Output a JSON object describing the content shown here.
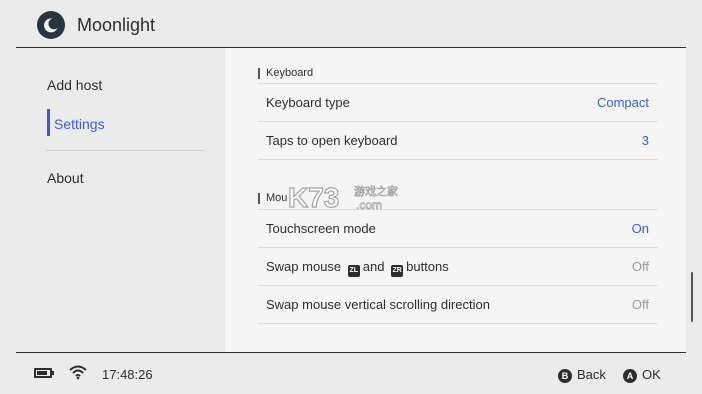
{
  "header": {
    "title": "Moonlight"
  },
  "sidebar": {
    "items": [
      {
        "label": "Add host"
      },
      {
        "label": "Settings"
      },
      {
        "label": "About"
      }
    ]
  },
  "sections": {
    "keyboard": {
      "title": "Keyboard",
      "rows": [
        {
          "label": "Keyboard type",
          "value": "Compact"
        },
        {
          "label": "Taps to open keyboard",
          "value": "3"
        }
      ]
    },
    "mouse": {
      "title": "Mou",
      "rows": [
        {
          "label": "Touchscreen mode",
          "value": "On"
        },
        {
          "label_prefix": "Swap mouse",
          "glyph_left": "ZL",
          "label_mid": "and",
          "glyph_right": "ZR",
          "label_suffix": "buttons",
          "value": "Off"
        },
        {
          "label": "Swap mouse vertical scrolling direction",
          "value": "Off"
        }
      ]
    }
  },
  "watermark": {
    "brand": "K73",
    "cn": "游戏之家",
    "domain": ".com"
  },
  "footer": {
    "time": "17:48:26",
    "back": {
      "glyph": "B",
      "label": "Back"
    },
    "ok": {
      "glyph": "A",
      "label": "OK"
    }
  },
  "colors": {
    "accent": "#3c5bd0",
    "off": "#9a9a9a"
  }
}
